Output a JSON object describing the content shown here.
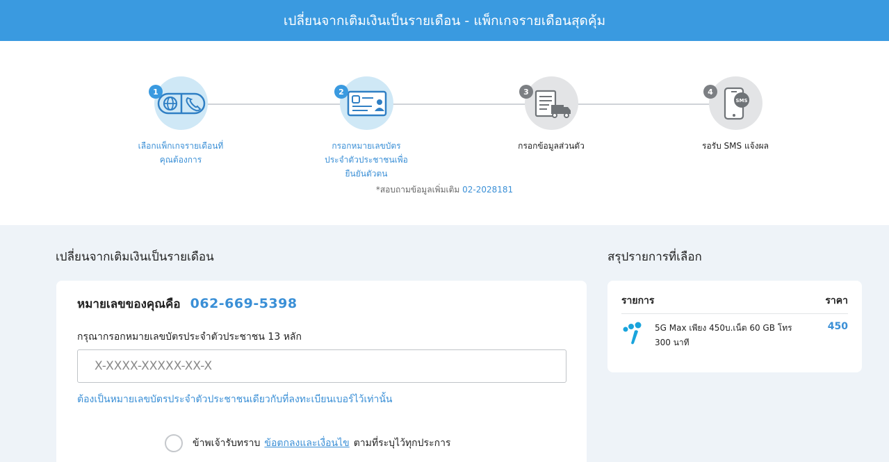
{
  "header": {
    "title": "เปลี่ยนจากเติมเงินเป็นรายเดือน - แพ็กเกจรายเดือนสุดคุ้ม"
  },
  "steps": [
    {
      "number": "1",
      "label": "เลือกแพ็กเกจรายเดือนที่คุณต้องการ",
      "state": "active",
      "icon": "globe-phone-icon"
    },
    {
      "number": "2",
      "label": "กรอกหมายเลขบัตรประจำตัวประชาชนเพื่อยืนยันตัวตน",
      "state": "active",
      "icon": "id-card-icon"
    },
    {
      "number": "3",
      "label": "กรอกข้อมูลส่วนตัว",
      "state": "inactive",
      "icon": "form-delivery-icon"
    },
    {
      "number": "4",
      "label": "รอรับ SMS แจ้งผล",
      "state": "inactive",
      "icon": "phone-sms-icon"
    }
  ],
  "contact": {
    "text": "*สอบถามข้อมูลเพิ่มเติม",
    "phone": "02-2028181"
  },
  "form": {
    "section_title": "เปลี่ยนจากเติมเงินเป็นรายเดือน",
    "number_label": "หมายเลขของคุณคือ",
    "number_value": "062-669-5398",
    "id_label": "กรุณากรอกหมายเลขบัตรประจำตัวประชาชน 13 หลัก",
    "id_value": "",
    "id_placeholder": "X-XXXX-XXXXX-XX-X",
    "id_note": "ต้องเป็นหมายเลขบัตรประจำตัวประชาชนเดียวกับที่ลงทะเบียนเบอร์ไว้เท่านั้น",
    "consent_before": "ข้าพเจ้ารับทราบ",
    "consent_link": "ข้อตกลงและเงื่อนไข",
    "consent_after": "ตามที่ระบุไว้ทุกประการ"
  },
  "summary": {
    "section_title": "สรุปรายการที่เลือก",
    "col_item": "รายการ",
    "col_price": "ราคา",
    "item_desc": "5G Max เพียง 450บ.เน็ต 60 GB โทร 300 นาที",
    "item_price": "450",
    "brand_icon": "dtac-logo-icon"
  },
  "colors": {
    "accent": "#3a9ae0",
    "link": "#3a8fd6",
    "bg_main": "#eef3f8"
  }
}
